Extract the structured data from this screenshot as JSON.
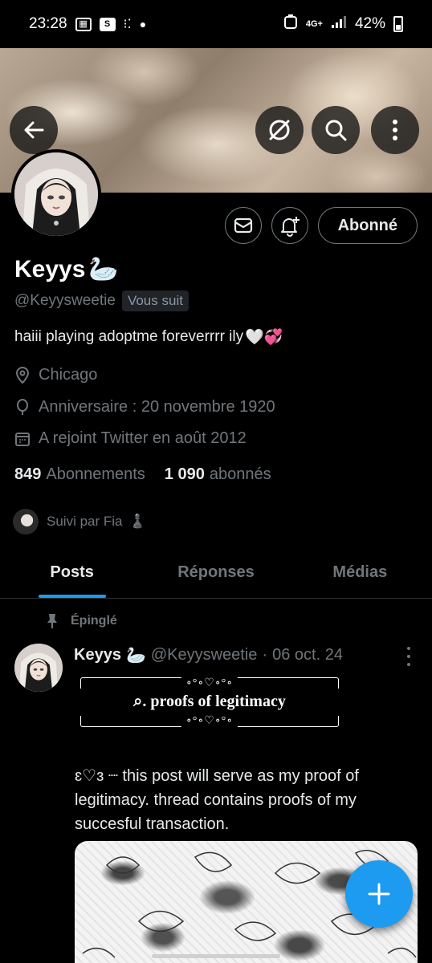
{
  "status": {
    "time": "23:28",
    "left_icons": [
      "gallery-icon",
      "s-icon",
      "steps-icon",
      "dot-icon"
    ],
    "network": "4G+",
    "battery": "42%"
  },
  "profile": {
    "display_name": "Keyys",
    "name_emoji": "🦢",
    "handle": "@Keyysweetie",
    "follows_you": "Vous suit",
    "bio": "haiii playing adoptme foreverrrr ily",
    "bio_emoji": "🤍💞",
    "location": "Chicago",
    "birthday": "Anniversaire : 20 novembre 1920",
    "joined": "A rejoint Twitter en août 2012",
    "following_count": "849",
    "following_label": "Abonnements",
    "followers_count": "1 090",
    "followers_label": "abonnés",
    "followed_by": "Suivi par Fia",
    "followed_by_emoji": "♟️",
    "follow_button": "Abonné"
  },
  "tabs": [
    {
      "label": "Posts",
      "active": true
    },
    {
      "label": "Réponses",
      "active": false
    },
    {
      "label": "Médias",
      "active": false
    }
  ],
  "post": {
    "pinned_label": "Épinglé",
    "author": "Keyys",
    "author_emoji": "🦢",
    "handle": "@Keyysweetie",
    "separator": "·",
    "date": "06 oct. 24",
    "ornament": "∘°∘♡∘°∘",
    "banner_title": "⌕. proofs of legitimacy",
    "body": "ɛ♡ɜ ┈ this post will serve as my proof of legitimacy. thread contains proofs of my succesful transaction."
  },
  "colors": {
    "accent": "#1d9bf0",
    "muted": "#71767b",
    "text": "#e7e9ea",
    "border": "#2f3336"
  }
}
